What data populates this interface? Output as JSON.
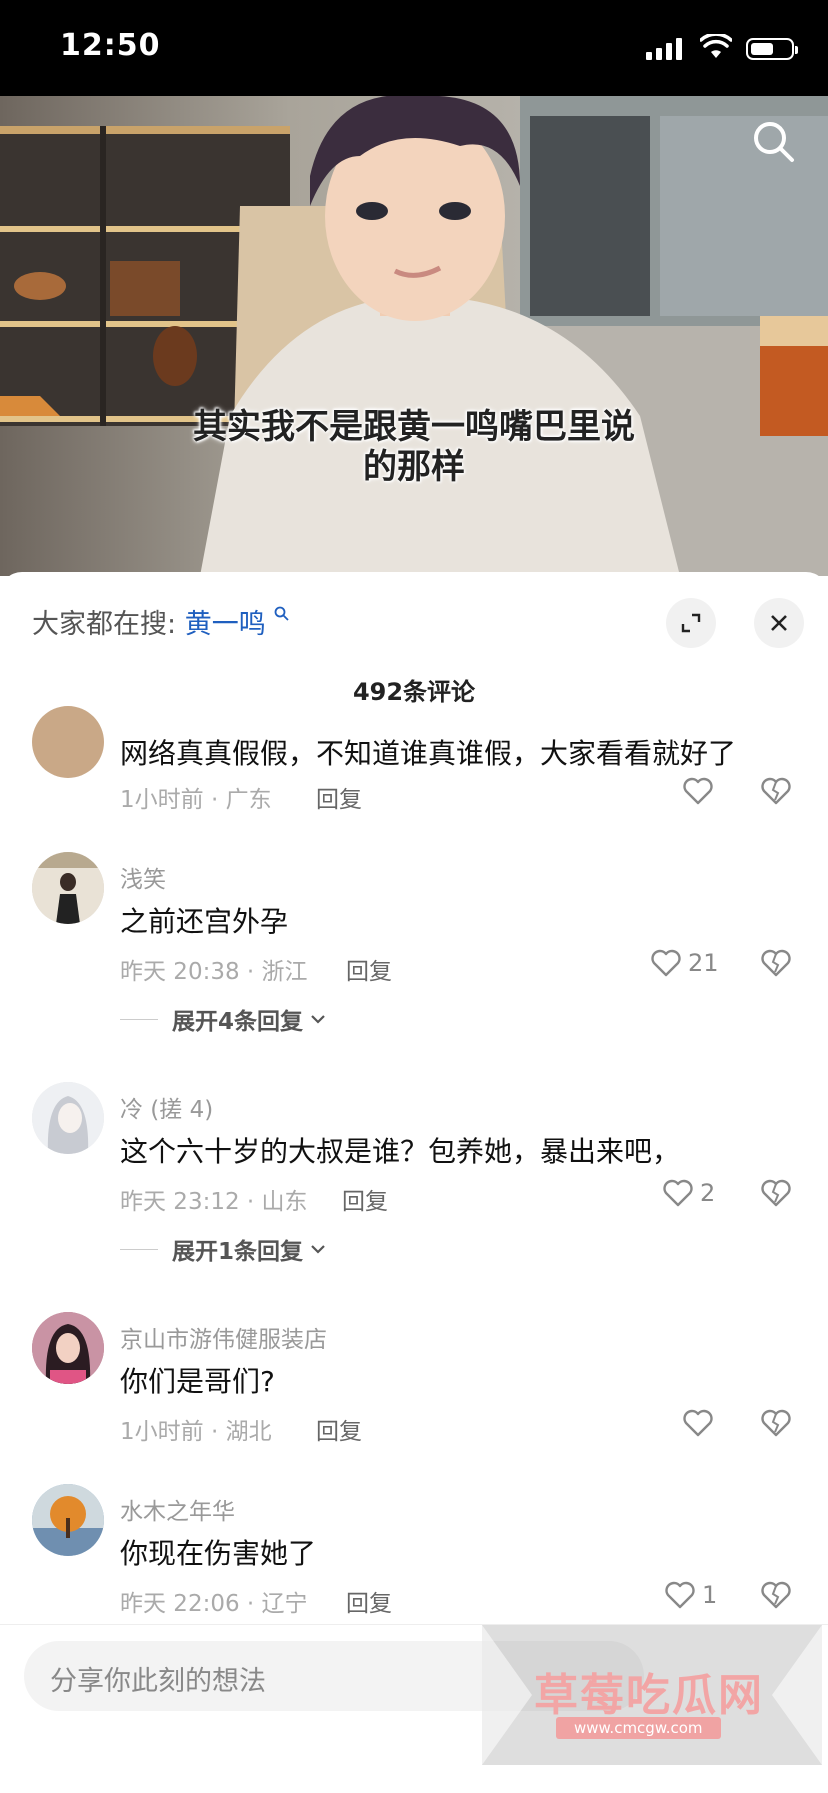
{
  "status_bar": {
    "time": "12:50"
  },
  "video": {
    "subtitle_line1": "其实我不是跟黄一鸣嘴巴里说",
    "subtitle_line2": "的那样"
  },
  "panel": {
    "search_hint_label": "大家都在搜:",
    "search_keyword": "黄一鸣",
    "comment_count": "492条评论"
  },
  "comments": [
    {
      "text": "网络真真假假，不知道谁真谁假，大家看看就好了",
      "meta": "1小时前 · 广东",
      "reply": "回复",
      "likes": ""
    },
    {
      "user": "浅笑",
      "text": "之前还宫外孕",
      "meta": "昨天 20:38 · 浙江",
      "reply": "回复",
      "likes": "21",
      "expand": "展开4条回复"
    },
    {
      "user": "冷 (搓 4)",
      "text": "这个六十岁的大叔是谁？包养她，暴出来吧，",
      "meta": "昨天 23:12 · 山东",
      "reply": "回复",
      "likes": "2",
      "expand": "展开1条回复"
    },
    {
      "user": "京山市游伟健服装店",
      "text": "你们是哥们?",
      "meta": "1小时前 · 湖北",
      "reply": "回复",
      "likes": ""
    },
    {
      "user": "水木之年华",
      "text": "你现在伤害她了",
      "meta": "昨天 22:06 · 辽宁",
      "reply": "回复",
      "likes": "1"
    }
  ],
  "input": {
    "placeholder": "分享你此刻的想法"
  },
  "watermark": {
    "title": "草莓吃瓜网",
    "url": "www.cmcgw.com"
  }
}
